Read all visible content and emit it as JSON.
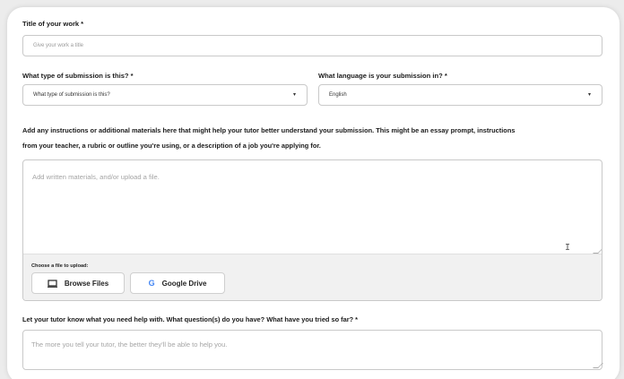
{
  "title_field": {
    "label": "Title of your work",
    "required_mark": "*",
    "placeholder": "Give your work a title"
  },
  "submission_type": {
    "label": "What type of submission is this?",
    "required_mark": "*",
    "selected": "What type of submission is this?"
  },
  "language": {
    "label": "What language is your submission in?",
    "required_mark": "*",
    "selected": "English"
  },
  "instructions": {
    "text_line1": "Add any instructions or additional materials here that might help your tutor better understand your submission. This might be an essay prompt, instructions",
    "text_line2": "from your teacher, a rubric or outline you're using, or a description of a job you're applying for.",
    "placeholder": "Add written materials, and/or upload a file.",
    "upload_label": "Choose a file to upload:",
    "browse_label": "Browse Files",
    "drive_label": "Google Drive",
    "drive_letter": "G",
    "drive_color": "#4285F4"
  },
  "help": {
    "label": "Let your tutor know what you need help with. What question(s) do you have? What have you tried so far?",
    "required_mark": "*",
    "placeholder": "The more you tell your tutor, the better they'll be able to help you."
  },
  "icons": {
    "caret": "▾",
    "monitor": "monitor-icon",
    "google": "google-icon"
  }
}
